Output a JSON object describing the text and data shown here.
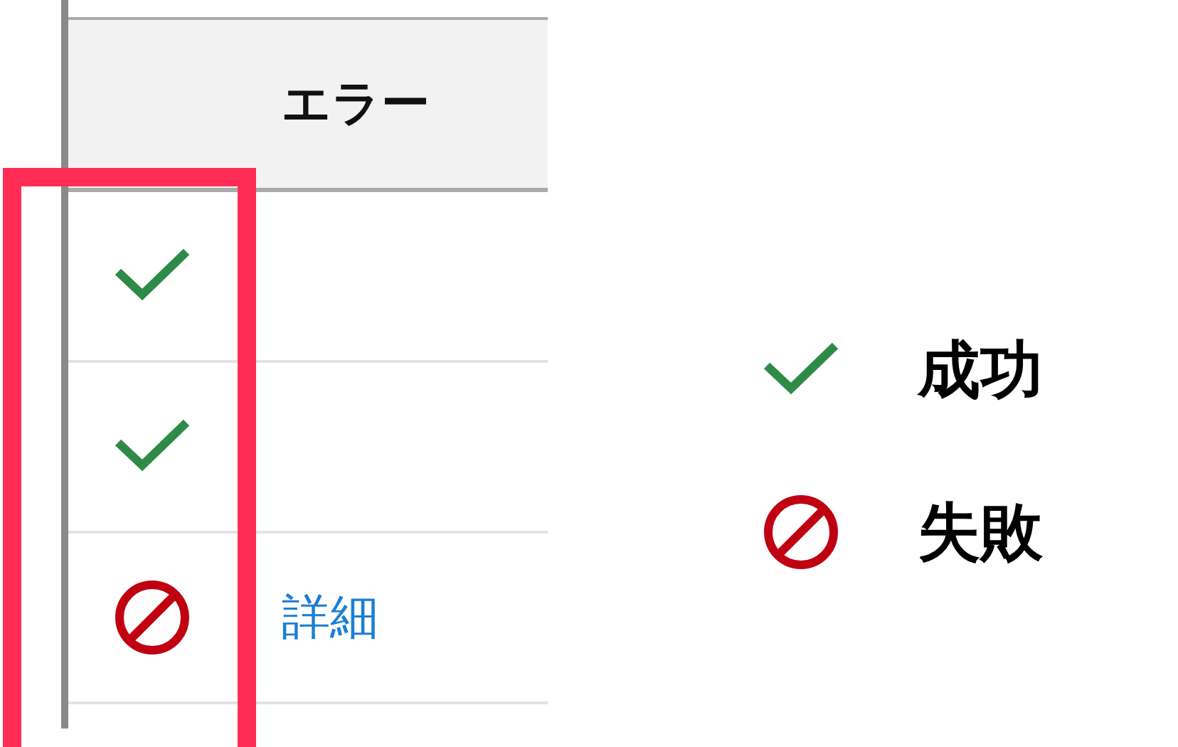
{
  "table": {
    "header": "エラー",
    "rows": [
      {
        "kind": "success"
      },
      {
        "kind": "success"
      },
      {
        "kind": "failure",
        "link": "詳細"
      }
    ]
  },
  "legend": [
    {
      "kind": "success",
      "label": "成功"
    },
    {
      "kind": "failure",
      "label": "失敗"
    }
  ]
}
